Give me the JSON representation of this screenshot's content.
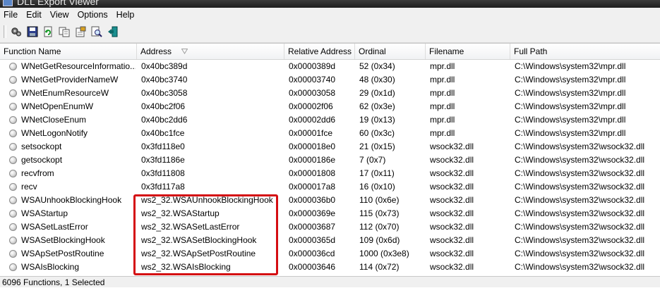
{
  "window": {
    "title": "DLL Export Viewer"
  },
  "menu": [
    "File",
    "Edit",
    "View",
    "Options",
    "Help"
  ],
  "toolbar": [
    "properties-icon",
    "save-icon",
    "refresh-icon",
    "copy-icon",
    "html-report-icon",
    "find-icon",
    "exit-icon"
  ],
  "columns": [
    "Function Name",
    "Address",
    "Relative Address",
    "Ordinal",
    "Filename",
    "Full Path"
  ],
  "rows": [
    {
      "name": "WNetGetResourceInformatio...",
      "address": "0x40bc389d",
      "rel": "0x0000389d",
      "ordinal": "52 (0x34)",
      "file": "mpr.dll",
      "path": "C:\\Windows\\system32\\mpr.dll"
    },
    {
      "name": "WNetGetProviderNameW",
      "address": "0x40bc3740",
      "rel": "0x00003740",
      "ordinal": "48 (0x30)",
      "file": "mpr.dll",
      "path": "C:\\Windows\\system32\\mpr.dll"
    },
    {
      "name": "WNetEnumResourceW",
      "address": "0x40bc3058",
      "rel": "0x00003058",
      "ordinal": "29 (0x1d)",
      "file": "mpr.dll",
      "path": "C:\\Windows\\system32\\mpr.dll"
    },
    {
      "name": "WNetOpenEnumW",
      "address": "0x40bc2f06",
      "rel": "0x00002f06",
      "ordinal": "62 (0x3e)",
      "file": "mpr.dll",
      "path": "C:\\Windows\\system32\\mpr.dll"
    },
    {
      "name": "WNetCloseEnum",
      "address": "0x40bc2dd6",
      "rel": "0x00002dd6",
      "ordinal": "19 (0x13)",
      "file": "mpr.dll",
      "path": "C:\\Windows\\system32\\mpr.dll"
    },
    {
      "name": "WNetLogonNotify",
      "address": "0x40bc1fce",
      "rel": "0x00001fce",
      "ordinal": "60 (0x3c)",
      "file": "mpr.dll",
      "path": "C:\\Windows\\system32\\mpr.dll"
    },
    {
      "name": "setsockopt",
      "address": "0x3fd118e0",
      "rel": "0x000018e0",
      "ordinal": "21 (0x15)",
      "file": "wsock32.dll",
      "path": "C:\\Windows\\system32\\wsock32.dll"
    },
    {
      "name": "getsockopt",
      "address": "0x3fd1186e",
      "rel": "0x0000186e",
      "ordinal": "7 (0x7)",
      "file": "wsock32.dll",
      "path": "C:\\Windows\\system32\\wsock32.dll"
    },
    {
      "name": "recvfrom",
      "address": "0x3fd11808",
      "rel": "0x00001808",
      "ordinal": "17 (0x11)",
      "file": "wsock32.dll",
      "path": "C:\\Windows\\system32\\wsock32.dll"
    },
    {
      "name": "recv",
      "address": "0x3fd117a8",
      "rel": "0x000017a8",
      "ordinal": "16 (0x10)",
      "file": "wsock32.dll",
      "path": "C:\\Windows\\system32\\wsock32.dll"
    },
    {
      "name": "WSAUnhookBlockingHook",
      "address": "ws2_32.WSAUnhookBlockingHook",
      "rel": "0x000036b0",
      "ordinal": "110 (0x6e)",
      "file": "wsock32.dll",
      "path": "C:\\Windows\\system32\\wsock32.dll"
    },
    {
      "name": "WSAStartup",
      "address": "ws2_32.WSAStartup",
      "rel": "0x0000369e",
      "ordinal": "115 (0x73)",
      "file": "wsock32.dll",
      "path": "C:\\Windows\\system32\\wsock32.dll"
    },
    {
      "name": "WSASetLastError",
      "address": "ws2_32.WSASetLastError",
      "rel": "0x00003687",
      "ordinal": "112 (0x70)",
      "file": "wsock32.dll",
      "path": "C:\\Windows\\system32\\wsock32.dll"
    },
    {
      "name": "WSASetBlockingHook",
      "address": "ws2_32.WSASetBlockingHook",
      "rel": "0x0000365d",
      "ordinal": "109 (0x6d)",
      "file": "wsock32.dll",
      "path": "C:\\Windows\\system32\\wsock32.dll"
    },
    {
      "name": "WSApSetPostRoutine",
      "address": "ws2_32.WSApSetPostRoutine",
      "rel": "0x000036cd",
      "ordinal": "1000 (0x3e8)",
      "file": "wsock32.dll",
      "path": "C:\\Windows\\system32\\wsock32.dll"
    },
    {
      "name": "WSAIsBlocking",
      "address": "ws2_32.WSAIsBlocking",
      "rel": "0x00003646",
      "ordinal": "114 (0x72)",
      "file": "wsock32.dll",
      "path": "C:\\Windows\\system32\\wsock32.dll"
    }
  ],
  "status": "6096 Functions, 1 Selected",
  "colors": {
    "highlight_border": "#d40d12"
  }
}
